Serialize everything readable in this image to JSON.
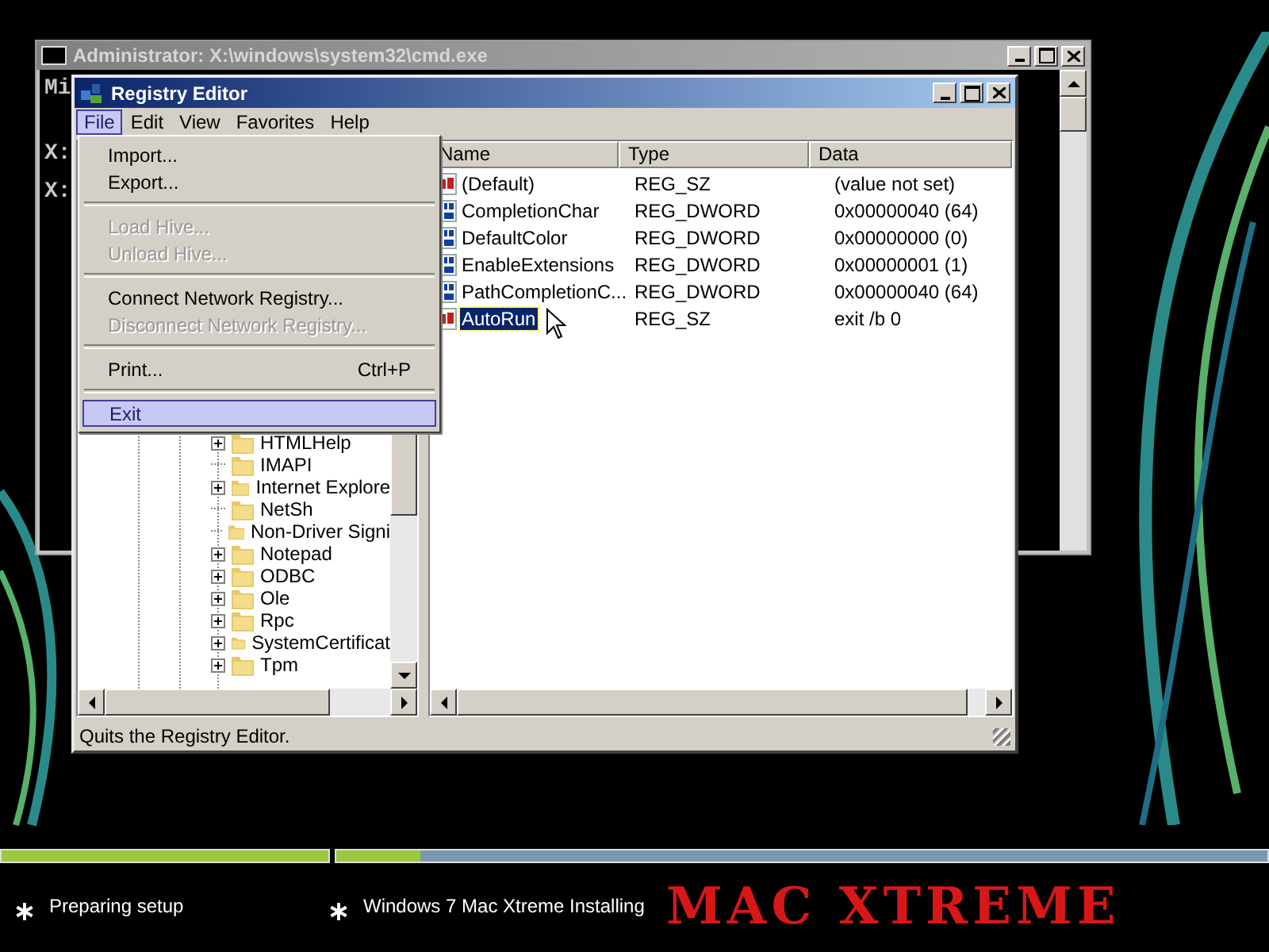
{
  "cmd_window": {
    "title": "Administrator: X:\\windows\\system32\\cmd.exe",
    "lines": [
      "Mi",
      "X:",
      "X:"
    ]
  },
  "registry_editor": {
    "title": "Registry Editor",
    "menu": [
      {
        "label": "File",
        "selected": true
      },
      {
        "label": "Edit",
        "selected": false
      },
      {
        "label": "View",
        "selected": false
      },
      {
        "label": "Favorites",
        "selected": false
      },
      {
        "label": "Help",
        "selected": false
      }
    ],
    "file_menu": [
      [
        {
          "label": "Import...",
          "disabled": false,
          "selected": false
        },
        {
          "label": "Export...",
          "disabled": false,
          "selected": false
        }
      ],
      [
        {
          "label": "Load Hive...",
          "disabled": true,
          "selected": false
        },
        {
          "label": "Unload Hive...",
          "disabled": true,
          "selected": false
        }
      ],
      [
        {
          "label": "Connect Network Registry...",
          "disabled": false,
          "selected": false
        },
        {
          "label": "Disconnect Network Registry...",
          "disabled": true,
          "selected": false
        }
      ],
      [
        {
          "label": "Print...",
          "shortcut": "Ctrl+P",
          "disabled": false,
          "selected": false
        }
      ],
      [
        {
          "label": "Exit",
          "disabled": false,
          "selected": true
        }
      ]
    ],
    "tree": [
      {
        "label": "HTMLHelp",
        "expandable": true
      },
      {
        "label": "IMAPI",
        "expandable": false
      },
      {
        "label": "Internet Explore",
        "expandable": true
      },
      {
        "label": "NetSh",
        "expandable": false
      },
      {
        "label": "Non-Driver Signi",
        "expandable": false
      },
      {
        "label": "Notepad",
        "expandable": true
      },
      {
        "label": "ODBC",
        "expandable": true
      },
      {
        "label": "Ole",
        "expandable": true
      },
      {
        "label": "Rpc",
        "expandable": true
      },
      {
        "label": "SystemCertificat",
        "expandable": true
      },
      {
        "label": "Tpm",
        "expandable": true
      }
    ],
    "columns": [
      "Name",
      "Type",
      "Data"
    ],
    "values": [
      {
        "kind": "string",
        "name": "(Default)",
        "type": "REG_SZ",
        "data": "(value not set)",
        "selected": false
      },
      {
        "kind": "dword",
        "name": "CompletionChar",
        "type": "REG_DWORD",
        "data": "0x00000040 (64)",
        "selected": false
      },
      {
        "kind": "dword",
        "name": "DefaultColor",
        "type": "REG_DWORD",
        "data": "0x00000000 (0)",
        "selected": false
      },
      {
        "kind": "dword",
        "name": "EnableExtensions",
        "type": "REG_DWORD",
        "data": "0x00000001 (1)",
        "selected": false
      },
      {
        "kind": "dword",
        "name": "PathCompletionC...",
        "type": "REG_DWORD",
        "data": "0x00000040 (64)",
        "selected": false
      },
      {
        "kind": "string",
        "name": "AutoRun",
        "type": "REG_SZ",
        "data": "exit /b 0",
        "selected": true
      }
    ],
    "status_bar": "Quits the Registry Editor."
  },
  "setup": {
    "progress": [
      {
        "level": 1
      },
      {
        "level": 0.09
      }
    ],
    "steps": [
      {
        "label": "Preparing setup"
      },
      {
        "label": "Windows 7 Mac Xtreme Installing"
      }
    ],
    "logo": "MAC XTREME"
  }
}
